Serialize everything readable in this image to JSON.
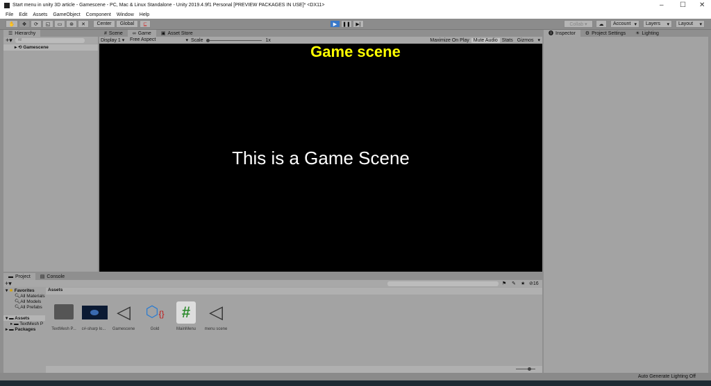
{
  "window": {
    "title": "Start menu in unity 3D article - Gamescene - PC, Mac & Linux Standalone - Unity 2019.4.9f1 Personal [PREVIEW PACKAGES IN USE]* <DX11>",
    "minimize": "–",
    "maximize": "☐",
    "close": "✕"
  },
  "menu": [
    "File",
    "Edit",
    "Assets",
    "GameObject",
    "Component",
    "Window",
    "Help"
  ],
  "toolbar": {
    "center": "Center",
    "global": "Global",
    "collab": "Collab ▾",
    "account": "Account",
    "layers": "Layers",
    "layout": "Layout"
  },
  "hierarchy": {
    "tab": "Hierarchy",
    "search_placeholder": "All",
    "item": "Gamescene"
  },
  "game": {
    "tabs": [
      "Scene",
      "Game",
      "Asset Store"
    ],
    "display": "Display 1",
    "aspect": "Free Aspect",
    "scale_label": "Scale",
    "scale_value": "1x",
    "maximize": "Maximize On Play",
    "mute": "Mute Audio",
    "stats": "Stats",
    "gizmos": "Gizmos",
    "heading": "Game scene",
    "body_text": "This is a Game Scene"
  },
  "inspector": {
    "tabs": [
      "Inspector",
      "Project Settings",
      "Lighting"
    ]
  },
  "project": {
    "tabs": [
      "Project",
      "Console"
    ],
    "favorites": "Favorites",
    "fav_items": [
      "All Materials",
      "All Models",
      "All Prefabs"
    ],
    "assets_root": "Assets",
    "assets_child": "TextMesh P",
    "packages": "Packages",
    "breadcrumb": "Assets",
    "hidden_count": "16",
    "assets": [
      "TextMesh P...",
      "c#-sharp lo...",
      "Gamescene",
      "Gold",
      "MainMenu",
      "menu scene"
    ]
  },
  "status": {
    "text": "Auto Generate Lighting Off"
  },
  "colors": {
    "heading": "#ffff00",
    "play": "#3a78c8"
  }
}
